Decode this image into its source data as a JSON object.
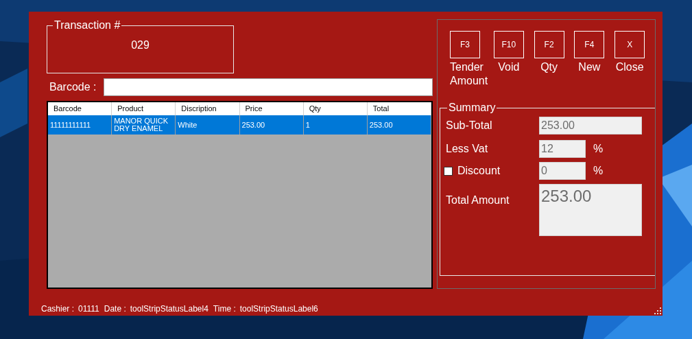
{
  "transaction": {
    "title": "Transaction #",
    "number": "029"
  },
  "barcode": {
    "label": "Barcode :"
  },
  "table": {
    "columns": [
      "Barcode",
      "Product",
      "Discription",
      "Price",
      "Qty",
      "Total"
    ],
    "rows": [
      {
        "selected": true,
        "cells": [
          "11111111111",
          "MANOR QUICK DRY ENAMEL",
          "White",
          "253.00",
          "1",
          "253.00"
        ]
      }
    ]
  },
  "actions": [
    {
      "key": "F3",
      "label": "Tender Amount"
    },
    {
      "key": "F10",
      "label": "Void"
    },
    {
      "key": "F2",
      "label": "Qty"
    },
    {
      "key": "F4",
      "label": "New"
    },
    {
      "key": "X",
      "label": "Close"
    }
  ],
  "summary": {
    "title": "Summary",
    "sub_total": {
      "label": "Sub-Total",
      "value": "253.00"
    },
    "less_vat": {
      "label": "Less Vat",
      "value": "12",
      "unit": "%"
    },
    "discount": {
      "label": "Discount",
      "checked": false,
      "value": "0",
      "unit": "%"
    },
    "total": {
      "label": "Total Amount",
      "value": "253.00"
    }
  },
  "status_bar": [
    {
      "label": "Cashier :",
      "value": "01111"
    },
    {
      "label": "Date :",
      "value": "toolStripStatusLabel4"
    },
    {
      "label": "Time :",
      "value": "toolStripStatusLabel6"
    }
  ]
}
